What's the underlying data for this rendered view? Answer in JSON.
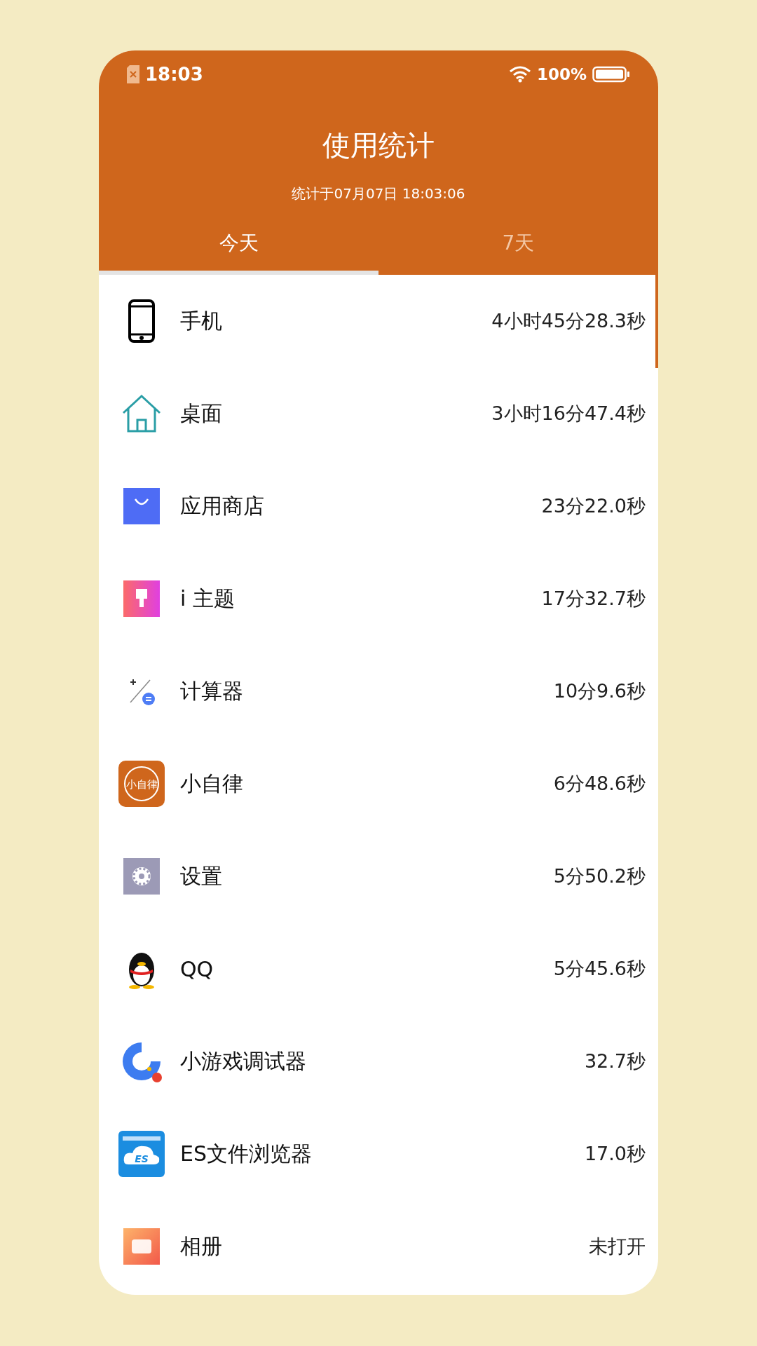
{
  "status_bar": {
    "time": "18:03",
    "battery": "100%"
  },
  "header": {
    "title": "使用统计",
    "subtitle": "统计于07月07日 18:03:06"
  },
  "tabs": [
    {
      "label": "今天",
      "selected": true
    },
    {
      "label": "7天",
      "selected": false
    }
  ],
  "apps": [
    {
      "kind": "phone",
      "name": "手机",
      "duration": "4小时45分28.3秒"
    },
    {
      "kind": "home",
      "name": "桌面",
      "duration": "3小时16分47.4秒"
    },
    {
      "kind": "store",
      "name": "应用商店",
      "duration": "23分22.0秒"
    },
    {
      "kind": "theme",
      "name": "i 主题",
      "duration": "17分32.7秒"
    },
    {
      "kind": "calculator",
      "name": "计算器",
      "duration": "10分9.6秒"
    },
    {
      "kind": "badge",
      "icon_label": "小自律",
      "name": "小自律",
      "duration": "6分48.6秒"
    },
    {
      "kind": "settings",
      "name": "设置",
      "duration": "5分50.2秒"
    },
    {
      "kind": "penguin",
      "name": "QQ",
      "duration": "5分45.6秒"
    },
    {
      "kind": "game",
      "name": "小游戏调试器",
      "duration": "32.7秒"
    },
    {
      "kind": "folder",
      "icon_label": "ES",
      "name": "ES文件浏览器",
      "duration": "17.0秒"
    },
    {
      "kind": "album",
      "name": "相册",
      "duration": "未打开"
    }
  ]
}
